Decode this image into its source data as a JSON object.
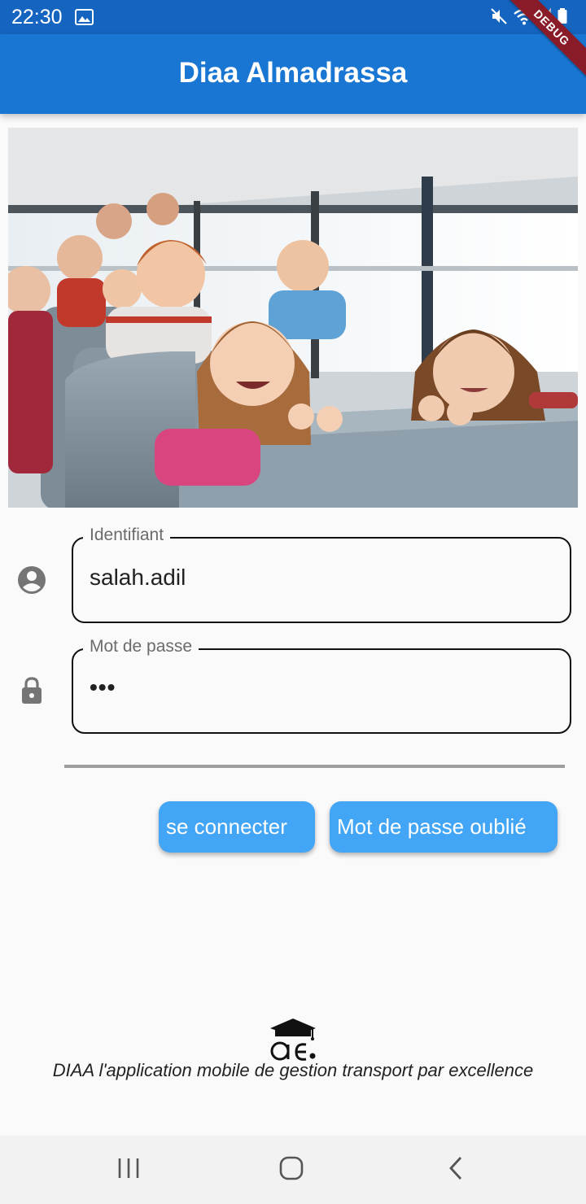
{
  "status_bar": {
    "time": "22:30",
    "icons": [
      "gallery-icon",
      "mute-icon",
      "wifi-icon",
      "signal-icon",
      "battery-icon"
    ],
    "background": "#1565c0"
  },
  "debug_banner": "DEBUG",
  "app_bar": {
    "title": "Diaa Almadrassa",
    "background": "#1976d2"
  },
  "hero_image": {
    "subject": "children smiling on a school bus"
  },
  "form": {
    "username": {
      "label": "Identifiant",
      "value": "salah.adil",
      "icon": "account-circle-icon"
    },
    "password": {
      "label": "Mot de passe",
      "value": "•••",
      "icon": "lock-icon"
    }
  },
  "buttons": {
    "login": "se connecter",
    "forgot_password": "Mot de passe oublié",
    "color": "#42a5f5"
  },
  "footer": {
    "tagline": "DIAA l'application mobile de gestion transport par excellence",
    "logo": "graduation-cap-logo"
  },
  "nav_bar": {
    "icons": [
      "recent-apps-icon",
      "home-icon",
      "back-icon"
    ]
  }
}
